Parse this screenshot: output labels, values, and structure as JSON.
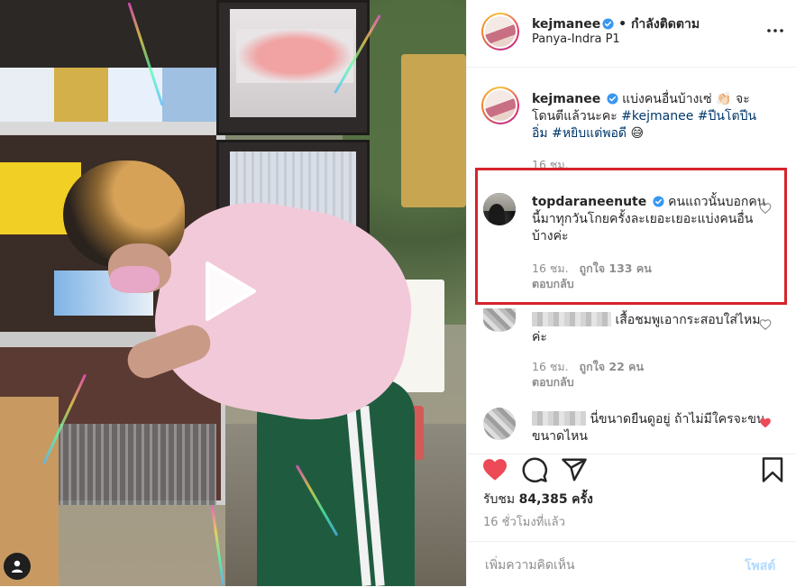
{
  "header": {
    "username": "kejmanee",
    "separator": " • ",
    "follow_status": "กำลังติดตาม",
    "location": "Panya-Indra P1"
  },
  "caption": {
    "username": "kejmanee",
    "text": "แบ่งคนอื่นบ้างเซ่ 👏🏻 จะโดนตีแล้วนะคะ",
    "hashtags": [
      "#kejmanee",
      "#ปีนโตปีนอิ่ม",
      "#หยิบแต่พอดี"
    ],
    "emoji": "😅",
    "time": "16 ชม."
  },
  "comments": [
    {
      "username": "topdaraneenute",
      "verified": true,
      "text": "คนแถวนั้นบอกคนนี้มาทุกวันโกยครั้งละเยอะเยอะแบ่งคนอื่นบ้างค่ะ",
      "time": "16 ชม.",
      "likes": "ถูกใจ 133 คน",
      "reply": "ตอบกลับ",
      "liked": false
    },
    {
      "username": "",
      "verified": false,
      "text": "เสื้อชมพูเอากระสอบใส่ไหมค่ะ",
      "time": "16 ชม.",
      "likes": "ถูกใจ 22 คน",
      "reply": "ตอบกลับ",
      "liked": false
    },
    {
      "username": "",
      "verified": false,
      "text": "นี่ขนาดยืนดูอยู่ ถ้าไม่มีใครจะขนขนาดไหน",
      "liked": true
    }
  ],
  "stats": {
    "views_label": "รับชม",
    "views_count": "84,385",
    "views_unit": "ครั้ง",
    "time": "16 ชั่วโมงที่แล้ว"
  },
  "add_comment": {
    "placeholder": "เพิ่มความคิดเห็น",
    "post_label": "โพสต์"
  },
  "colors": {
    "like_red": "#ed4956",
    "verified_blue": "#3897f0",
    "highlight_red": "#d6242b",
    "hashtag_blue": "#00376b"
  },
  "icons": [
    "heart-icon",
    "comment-icon",
    "share-icon",
    "bookmark-icon",
    "more-icon",
    "play-icon",
    "user-tag-icon"
  ]
}
